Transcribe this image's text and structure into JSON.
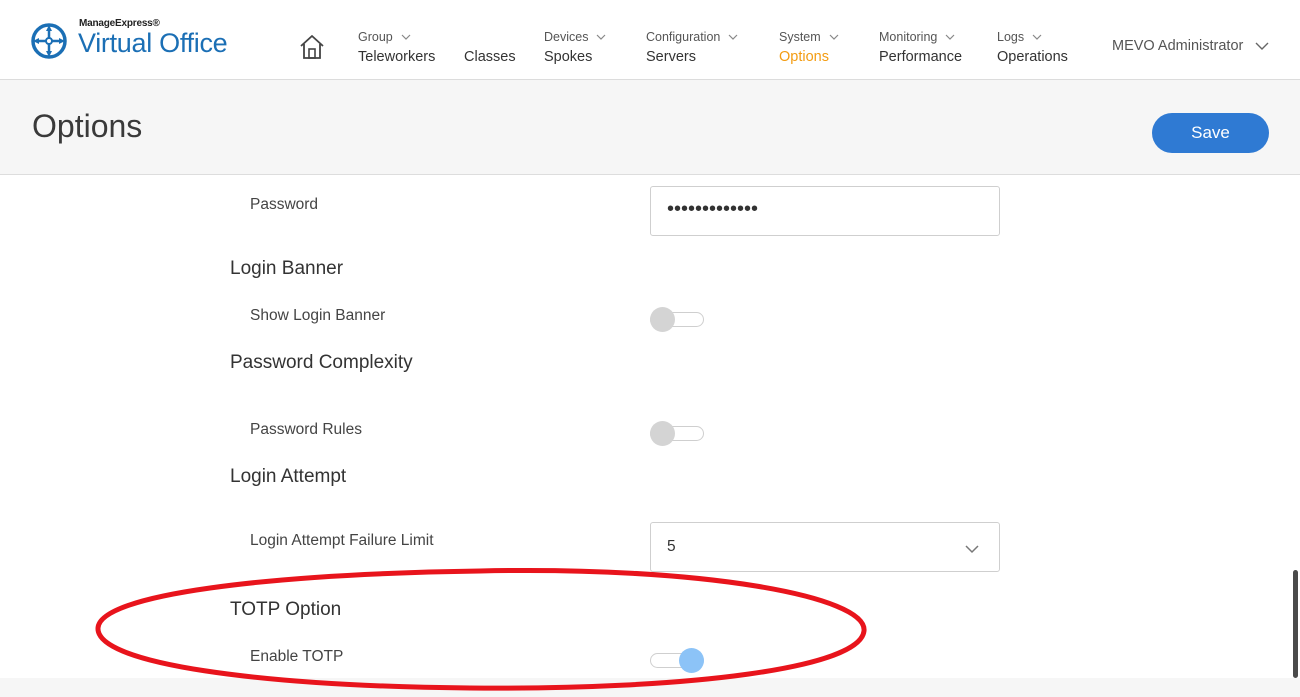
{
  "header": {
    "logo_small": "ManageExpress®",
    "logo_big": "Virtual Office",
    "nav": [
      {
        "category": "Group",
        "item": "Teleworkers",
        "has_menu": true
      },
      {
        "category": "",
        "item": "Classes",
        "has_menu": false
      },
      {
        "category": "Devices",
        "item": "Spokes",
        "has_menu": true
      },
      {
        "category": "Configuration",
        "item": "Servers",
        "has_menu": true
      },
      {
        "category": "System",
        "item": "Options",
        "has_menu": true,
        "active": true
      },
      {
        "category": "Monitoring",
        "item": "Performance",
        "has_menu": true
      },
      {
        "category": "Logs",
        "item": "Operations",
        "has_menu": true
      }
    ],
    "user": "MEVO Administrator"
  },
  "page": {
    "title": "Options",
    "save_label": "Save"
  },
  "form": {
    "password_label": "Password",
    "password_value": "•••••••••••••",
    "login_banner_section": "Login Banner",
    "show_login_banner_label": "Show Login Banner",
    "show_login_banner_on": false,
    "password_complexity_section": "Password Complexity",
    "password_rules_label": "Password Rules",
    "password_rules_on": false,
    "login_attempt_section": "Login Attempt",
    "failure_limit_label": "Login Attempt Failure Limit",
    "failure_limit_value": "5",
    "totp_section": "TOTP Option",
    "enable_totp_label": "Enable TOTP",
    "enable_totp_on": true
  },
  "colors": {
    "accent": "#f39c12",
    "primary_button": "#2f7ad3",
    "logo_blue": "#1b6fb5",
    "annotation_red": "#e8141c",
    "toggle_on_knob": "#8cc3f7"
  }
}
